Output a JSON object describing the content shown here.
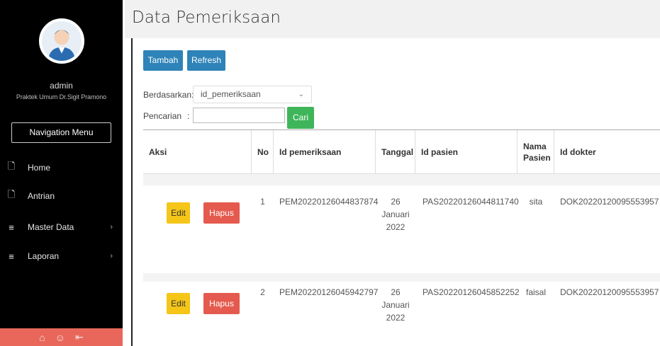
{
  "sidebar": {
    "user_name": "admin",
    "user_subtitle": "Praktek Umum Dr.Sigit Pramono",
    "nav_header": "Navigation Menu",
    "items": [
      {
        "label": "Home",
        "icon": "document-icon"
      },
      {
        "label": "Antrian",
        "icon": "document-icon"
      },
      {
        "label": "Master Data",
        "icon": "list-icon",
        "arrow": "›"
      },
      {
        "label": "Laporan",
        "icon": "list-icon",
        "arrow": "›"
      }
    ],
    "footer_icons": [
      "home-icon",
      "user-icon",
      "logout-icon"
    ],
    "footer_color": "#e8675a"
  },
  "page": {
    "title": "Data Pemeriksaan"
  },
  "toolbar": {
    "tambah_label": "Tambah",
    "refresh_label": "Refresh",
    "accent": "#2e83b8"
  },
  "filter": {
    "berdasarkan_label": "Berdasarkan:",
    "selected_option": "id_pemeriksaan",
    "pencarian_label": "Pencarian",
    "colon": ":",
    "search_value": "",
    "cari_label": "Cari"
  },
  "table": {
    "headers": {
      "aksi": "Aksi",
      "no": "No",
      "id_pemeriksaan": "Id pemeriksaan",
      "tanggal": "Tanggal",
      "id_pasien": "Id pasien",
      "nama_pasien_1": "Nama",
      "nama_pasien_2": "Pasien",
      "id_dokter": "Id dokter"
    },
    "edit_label": "Edit",
    "hapus_label": "Hapus",
    "rows": [
      {
        "no": "1",
        "id_pemeriksaan": "PEM20220126044837874",
        "tanggal_day": "26",
        "tanggal_month": "Januari",
        "tanggal_year": "2022",
        "id_pasien": "PAS20220126044811740",
        "nama_pasien": "sita",
        "id_dokter": "DOK20220120095553957"
      },
      {
        "no": "2",
        "id_pemeriksaan": "PEM20220126045942797",
        "tanggal_day": "26",
        "tanggal_month": "Januari",
        "tanggal_year": "2022",
        "id_pasien": "PAS20220126045852252",
        "nama_pasien": "faisal",
        "id_dokter": "DOK20220120095553957"
      }
    ]
  }
}
